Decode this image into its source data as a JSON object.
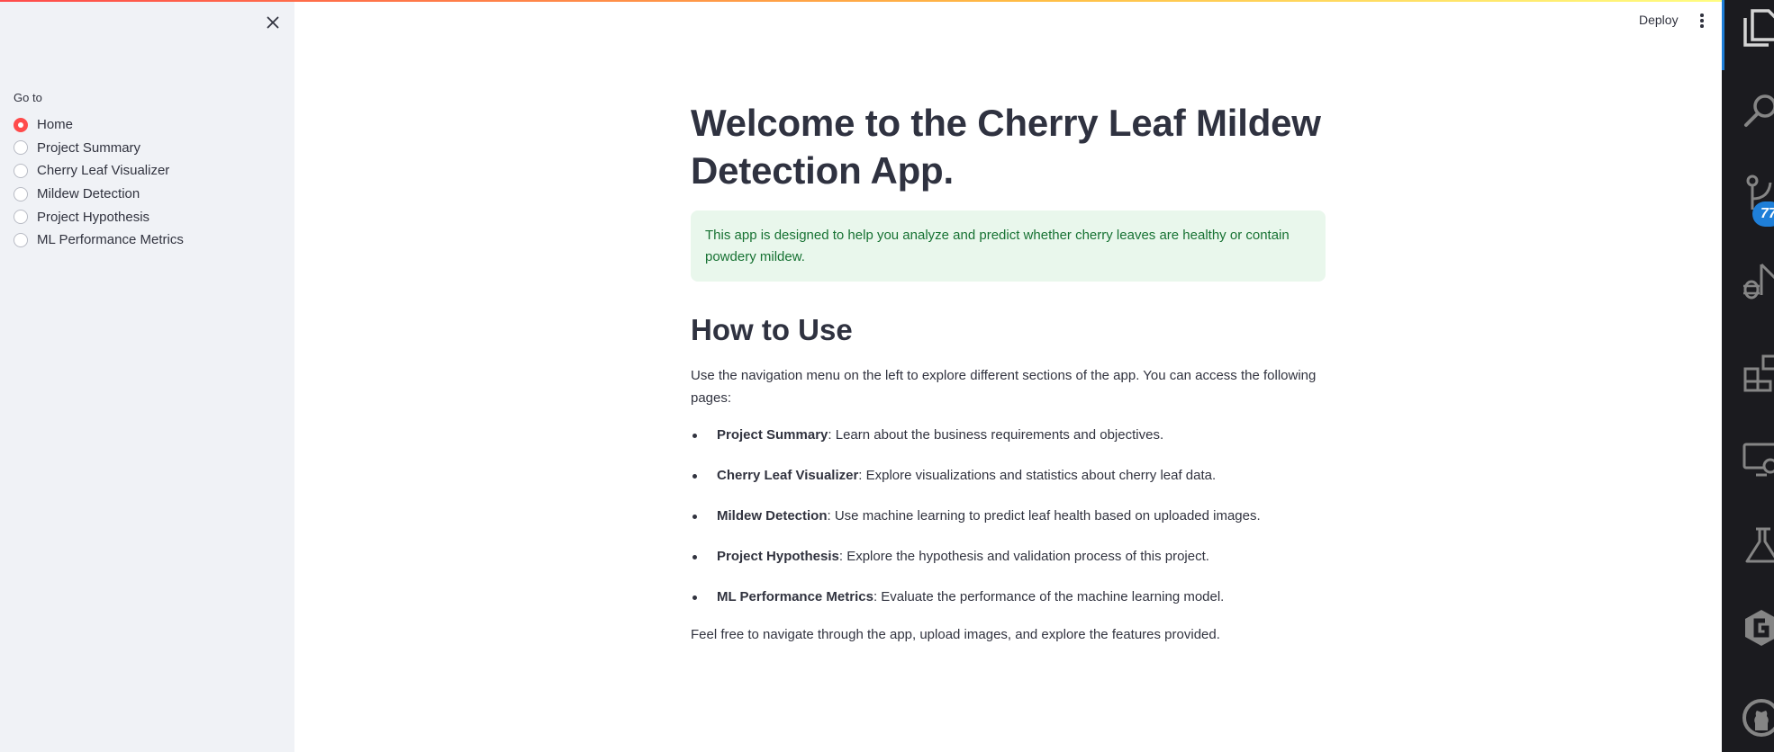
{
  "sidebar": {
    "goto_label": "Go to",
    "items": [
      {
        "label": "Home",
        "selected": true
      },
      {
        "label": "Project Summary",
        "selected": false
      },
      {
        "label": "Cherry Leaf Visualizer",
        "selected": false
      },
      {
        "label": "Mildew Detection",
        "selected": false
      },
      {
        "label": "Project Hypothesis",
        "selected": false
      },
      {
        "label": "ML Performance Metrics",
        "selected": false
      }
    ],
    "close_icon": "close-icon"
  },
  "header": {
    "deploy_label": "Deploy",
    "menu_icon": "kebab-menu-icon"
  },
  "main": {
    "title": "Welcome to the Cherry Leaf Mildew Detection App.",
    "info": "This app is designed to help you analyze and predict whether cherry leaves are healthy or contain powdery mildew.",
    "how_to_heading": "How to Use",
    "intro": "Use the navigation menu on the left to explore different sections of the app. You can access the following pages:",
    "bullets": [
      {
        "name": "Project Summary",
        "desc": ": Learn about the business requirements and objectives."
      },
      {
        "name": "Cherry Leaf Visualizer",
        "desc": ": Explore visualizations and statistics about cherry leaf data."
      },
      {
        "name": "Mildew Detection",
        "desc": ": Use machine learning to predict leaf health based on uploaded images."
      },
      {
        "name": "Project Hypothesis",
        "desc": ": Explore the hypothesis and validation process of this project."
      },
      {
        "name": "ML Performance Metrics",
        "desc": ": Evaluate the performance of the machine learning model."
      }
    ],
    "footer": "Feel free to navigate through the app, upload images, and explore the features provided."
  },
  "activity_bar": {
    "icons": [
      "explorer-icon",
      "search-icon",
      "source-control-icon",
      "run-debug-icon",
      "extensions-icon",
      "remote-explorer-icon",
      "testing-icon",
      "gitlens-icon",
      "github-icon"
    ],
    "badge": "77"
  },
  "colors": {
    "accent": "#ff4b4b",
    "sidebar_bg": "#f0f2f6",
    "info_bg": "#e9f7ec",
    "info_text": "#177233",
    "activity_bg": "#1b1b1f",
    "badge_bg": "#1f7fd8"
  }
}
